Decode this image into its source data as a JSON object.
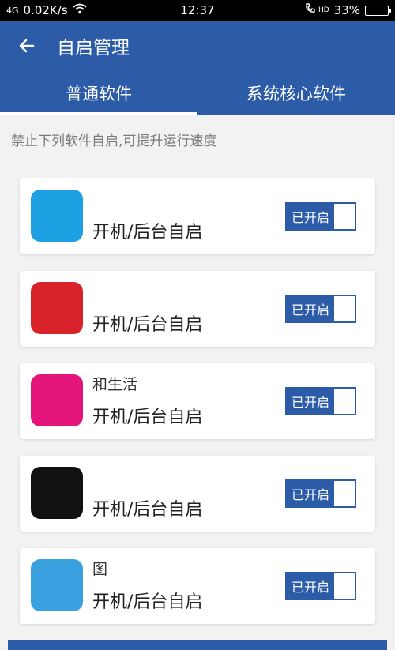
{
  "status_bar": {
    "network": "4G",
    "speed": "0.02K/s",
    "time": "12:37",
    "call": "HD",
    "battery": "33%",
    "battery_level": 0.33
  },
  "header": {
    "title": "自启管理"
  },
  "tabs": [
    {
      "label": "普通软件",
      "active": true
    },
    {
      "label": "系统核心软件",
      "active": false
    }
  ],
  "hint": "禁止下列软件自启,可提升运行速度",
  "apps": [
    {
      "name": "",
      "desc": "开机/后台自启",
      "toggle": "已开启",
      "icon_color": "#1da1e2"
    },
    {
      "name": "",
      "desc": "开机/后台自启",
      "toggle": "已开启",
      "icon_color": "#d9232a"
    },
    {
      "name": "和生活",
      "desc": "开机/后台自启",
      "toggle": "已开启",
      "icon_color": "#e4157a"
    },
    {
      "name": "",
      "desc": "开机/后台自启",
      "toggle": "已开启",
      "icon_color": "#111111"
    },
    {
      "name": "图",
      "desc": "开机/后台自启",
      "toggle": "已开启",
      "icon_color": "#3aa1e0"
    }
  ],
  "colors": {
    "primary": "#2c5ba8",
    "background": "#f2f2f2"
  }
}
